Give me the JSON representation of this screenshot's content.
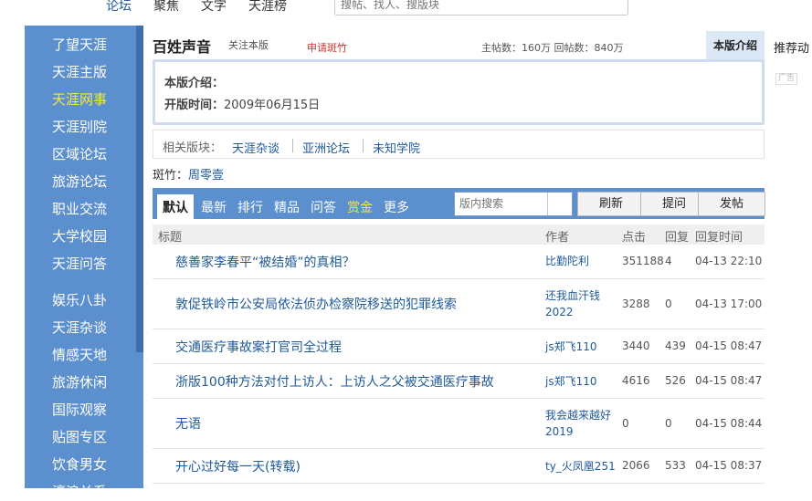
{
  "topnav": {
    "items": [
      "论坛",
      "聚焦",
      "文字",
      "天涯榜"
    ],
    "search_placeholder": "搜帖、找人、搜版块"
  },
  "sidebar": {
    "items": [
      "了望天涯",
      "天涯主版",
      "天涯网事",
      "天涯别院",
      "区域论坛",
      "旅游论坛",
      "职业交流",
      "大学校园",
      "天涯问答",
      "娱乐八卦",
      "天涯杂谈",
      "情感天地",
      "旅游休闲",
      "国际观察",
      "贴图专区",
      "饮食男女",
      "濠浪关系"
    ],
    "active_index": 2
  },
  "board": {
    "title": "百姓声音",
    "follow_label": "关注本版",
    "apply_label": "申请斑竹",
    "stats": "主帖数：160万 回帖数：840万",
    "intro_tab": "本版介绍",
    "recommend_label": "推荐动",
    "ad_label": "广告",
    "intro_label": "本版介绍：",
    "opened_label": "开版时间：",
    "opened_date": "2009年06月15日",
    "related_label": "相关版块：",
    "related": [
      "天涯杂谈",
      "亚洲论坛",
      "未知学院"
    ],
    "moderator_label": "斑竹：",
    "moderator_name": "周零壹"
  },
  "toolbar": {
    "tabs": [
      "默认",
      "最新",
      "排行",
      "精品",
      "问答",
      "赏金",
      "更多"
    ],
    "active_index": 0,
    "gold_index": 5,
    "search_placeholder": "版内搜索",
    "refresh_label": "刷新",
    "ask_label": "提问",
    "post_label": "发帖"
  },
  "table": {
    "headers": [
      "标题",
      "作者",
      "点击",
      "回复",
      "回复时间"
    ],
    "rows": [
      {
        "title": "慈善家李春平“被结婚”的真相？",
        "author": "比勤陀利",
        "clicks": "351188",
        "replies": "4",
        "time": "04-13 22:10"
      },
      {
        "title": "敦促铁岭市公安局依法侦办检察院移送的犯罪线索",
        "author": "还我血汗钱2022",
        "clicks": "3288",
        "replies": "0",
        "time": "04-13 17:00"
      },
      {
        "title": "交通医疗事故案打官司全过程",
        "author": "js郑飞110",
        "clicks": "3440",
        "replies": "439",
        "time": "04-15 08:47"
      },
      {
        "title": "浙版100种方法对付上访人：上访人之父被交通医疗事故",
        "author": "js郑飞110",
        "clicks": "4616",
        "replies": "526",
        "time": "04-15 08:47"
      },
      {
        "title": "无语",
        "author": "我会越来越好2019",
        "clicks": "0",
        "replies": "0",
        "time": "04-15 08:44"
      },
      {
        "title": "开心过好每一天(转载)",
        "author": "ty_火凤凰251",
        "clicks": "2066",
        "replies": "533",
        "time": "04-15 08:37"
      }
    ]
  }
}
